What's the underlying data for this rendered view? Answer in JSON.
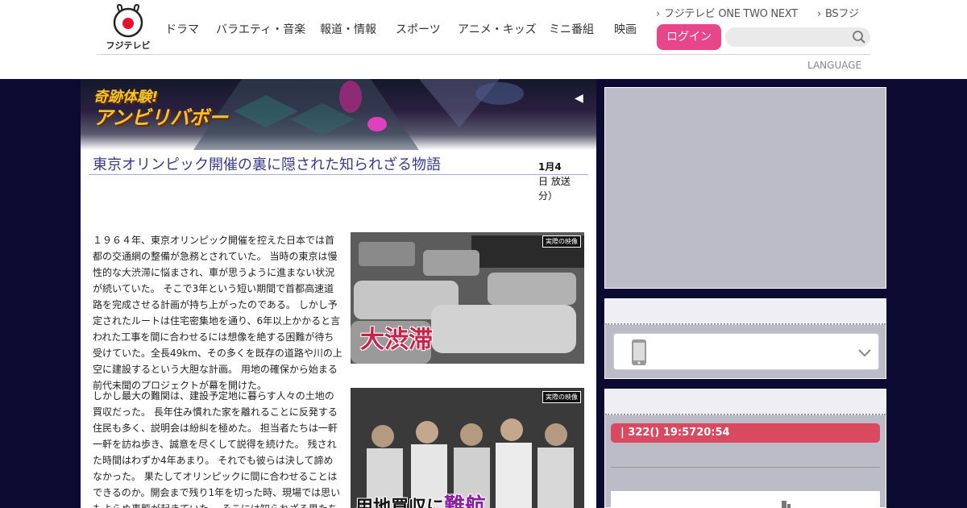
{
  "header": {
    "logo_text": "フジテレビ",
    "nav": [
      "ドラマ",
      "バラエティ・音楽",
      "報道・情報",
      "スポーツ",
      "アニメ・キッズ",
      "ミニ番組",
      "映画"
    ],
    "top_links": [
      "フジテレビ ONE TWO NEXT",
      "BSフジ"
    ],
    "login_label": "ログイン",
    "search_placeholder": "",
    "language_label": "LANGUAGE"
  },
  "banner": {
    "title_line1": "奇跡体験!",
    "title_line2": "アンビリバボー",
    "arrow": "◀"
  },
  "article": {
    "title": "東京オリンピック開催の裏に隠された知られざる物語",
    "date_block": [
      "1月4",
      "日 放送",
      "分）"
    ],
    "paragraph1": "１９６４年、東京オリンピック開催を控えた日本では首都の交通網の整備が急務とされていた。 当時の東京は慢性的な大渋滞に悩まされ、車が思うように進まない状況が続いていた。 そこで3年という短い期間で首都高速道路を完成させる計画が持ち上がったのである。 しかし予定されたルートは住宅密集地を通り、6年以上かかると言われた工事を間に合わせるには想像を絶する困難が待ち受けていた。全長49km、その多くを既存の道路や川の上空に建設するという大胆な計画。 用地の確保から始まる前代未聞のプロジェクトが幕を開けた。",
    "paragraph2": "しかし最大の難関は、建設予定地に暮らす人々の土地の買収だった。 長年住み慣れた家を離れることに反発する住民も多く、説明会は紛糾を極めた。 担当者たちは一軒一軒を訪ね歩き、誠意を尽くして説得を続けた。 残された時間はわずか4年あまり。 それでも彼らは決して諦めなかった。 果たしてオリンピックに間に合わせることはできるのか。開会まで残り1年を切った時、現場では思いもよらぬ事態が起きていた。 そこには知られざる男たちの壮絶な戦いがあったのだ。",
    "image1_caption": "大渋滞",
    "image1_stamp": "実際の映像",
    "image2_caption_a": "用地買収に",
    "image2_caption_b": "難航",
    "image2_stamp": "実際の映像"
  },
  "sidebar": {
    "notice": "| 322() 19:5720:54"
  },
  "colors": {
    "brand_pink": "#e7468b",
    "title_blue": "#3a3a8c",
    "notice_red": "#d94a60",
    "page_bg": "#0c0a30"
  }
}
